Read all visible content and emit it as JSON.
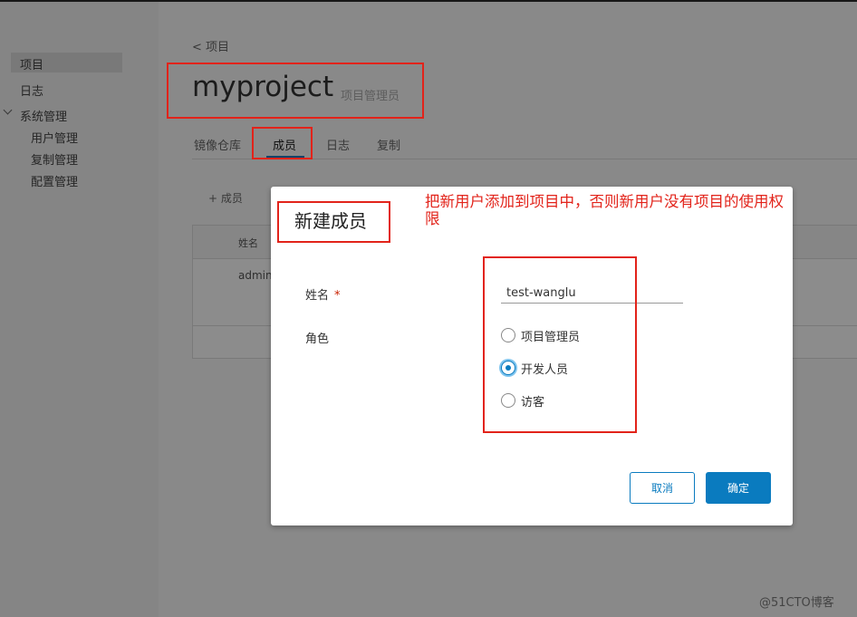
{
  "sidebar": {
    "items": [
      {
        "label": "项目",
        "active": true
      },
      {
        "label": "日志"
      },
      {
        "label": "系统管理",
        "children": [
          "用户管理",
          "复制管理",
          "配置管理"
        ]
      }
    ]
  },
  "project": {
    "back_link": "< 项目",
    "title": "myproject",
    "subtitle": "项目管理员"
  },
  "tabs": [
    "镜像仓库",
    "成员",
    "日志",
    "复制"
  ],
  "active_tab": "成员",
  "members": {
    "add_label": "+ 成员",
    "column_name": "姓名",
    "rows": [
      "admin"
    ]
  },
  "modal": {
    "title": "新建成员",
    "name_label": "姓名",
    "required_mark": "*",
    "name_value": "test-wanglu",
    "role_label": "角色",
    "roles": [
      "项目管理员",
      "开发人员",
      "访客"
    ],
    "selected_role": "开发人员",
    "cancel_label": "取消",
    "ok_label": "确定"
  },
  "annotation": {
    "text": "把新用户添加到项目中，否则新用户没有项目的使用权限"
  },
  "watermark": "@51CTO博客",
  "colors": {
    "primary": "#0a7bbf",
    "annotation_red": "#e2231a",
    "required_red": "#c92100"
  }
}
